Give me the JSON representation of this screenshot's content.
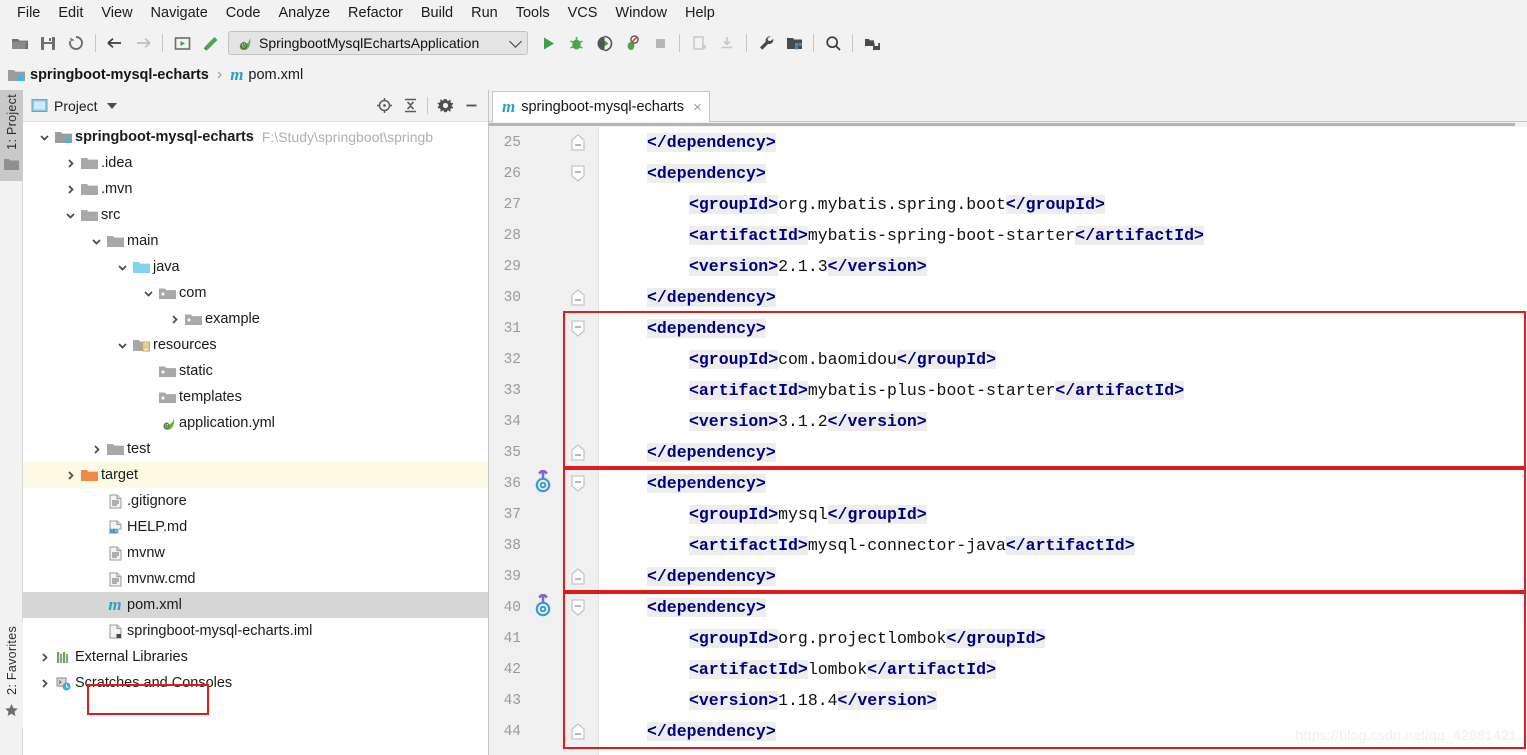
{
  "window": {
    "menu": [
      "File",
      "Edit",
      "View",
      "Navigate",
      "Code",
      "Analyze",
      "Refactor",
      "Build",
      "Run",
      "Tools",
      "VCS",
      "Window",
      "Help"
    ]
  },
  "toolbar": {
    "icons_left": [
      "open-folder-icon",
      "save-all-icon",
      "sync-icon",
      "back-arrow-icon",
      "forward-arrow-icon",
      "run-anything-icon",
      "build-hammer-icon"
    ],
    "run_config": {
      "label": "SpringbootMysqlEchartsApplication",
      "icon": "spring-boot-leaf-icon",
      "dropdown": "chevron-down-icon"
    },
    "icons_right": [
      "run-icon",
      "debug-icon",
      "run-with-coverage-icon",
      "profiler-icon",
      "stop-icon",
      "update-app-icon",
      "install-icon",
      "settings-wrench-icon",
      "project-structure-icon",
      "search-everywhere-icon",
      "save-layout-icon"
    ]
  },
  "breadcrumb": {
    "project": "springboot-mysql-echarts",
    "separator": "›",
    "file": "pom.xml",
    "file_icon": "maven-m-icon",
    "project_icon": "module-folder-icon"
  },
  "left_strips": [
    {
      "label": "1: Project",
      "icon": "project-folder-icon",
      "active": true
    },
    {
      "label": "2: Favorites",
      "icon": "star-icon",
      "active": false
    }
  ],
  "project_panel": {
    "title": "Project",
    "title_icon": "project-view-icon",
    "dropdown": "chevron-down-icon",
    "buttons": [
      "locate-target-icon",
      "collapse-all-icon",
      "settings-gear-icon",
      "hide-minus-icon"
    ],
    "tree": [
      {
        "label": "springboot-mysql-echarts",
        "path": "F:\\Study\\springboot\\springb",
        "depth": 0,
        "arrow": "down",
        "icon": "module-folder-icon",
        "bold": true,
        "state": "normal"
      },
      {
        "label": ".idea",
        "depth": 1,
        "arrow": "right",
        "icon": "folder-icon",
        "state": "normal"
      },
      {
        "label": ".mvn",
        "depth": 1,
        "arrow": "right",
        "icon": "folder-icon",
        "state": "normal"
      },
      {
        "label": "src",
        "depth": 1,
        "arrow": "down",
        "icon": "folder-icon",
        "state": "normal"
      },
      {
        "label": "main",
        "depth": 2,
        "arrow": "down",
        "icon": "folder-icon",
        "state": "normal"
      },
      {
        "label": "java",
        "depth": 3,
        "arrow": "down",
        "icon": "source-root-folder-icon",
        "state": "normal"
      },
      {
        "label": "com",
        "depth": 4,
        "arrow": "down",
        "icon": "package-icon",
        "state": "normal"
      },
      {
        "label": "example",
        "depth": 5,
        "arrow": "right",
        "icon": "package-icon",
        "state": "normal"
      },
      {
        "label": "resources",
        "depth": 3,
        "arrow": "down",
        "icon": "resource-root-folder-icon",
        "state": "normal"
      },
      {
        "label": "static",
        "depth": 4,
        "arrow": "none",
        "icon": "package-icon",
        "state": "normal"
      },
      {
        "label": "templates",
        "depth": 4,
        "arrow": "none",
        "icon": "package-icon",
        "state": "normal"
      },
      {
        "label": "application.yml",
        "depth": 4,
        "arrow": "none",
        "icon": "spring-yaml-icon",
        "state": "normal"
      },
      {
        "label": "test",
        "depth": 2,
        "arrow": "right",
        "icon": "folder-icon",
        "state": "normal"
      },
      {
        "label": "target",
        "depth": 1,
        "arrow": "right",
        "icon": "excluded-folder-icon",
        "state": "highlighted"
      },
      {
        "label": ".gitignore",
        "depth": 2,
        "arrow": "none",
        "icon": "text-file-icon",
        "state": "normal"
      },
      {
        "label": "HELP.md",
        "depth": 2,
        "arrow": "none",
        "icon": "markdown-file-icon",
        "state": "normal"
      },
      {
        "label": "mvnw",
        "depth": 2,
        "arrow": "none",
        "icon": "text-file-icon",
        "state": "normal"
      },
      {
        "label": "mvnw.cmd",
        "depth": 2,
        "arrow": "none",
        "icon": "text-file-icon",
        "state": "normal"
      },
      {
        "label": "pom.xml",
        "depth": 2,
        "arrow": "none",
        "icon": "maven-m-icon",
        "state": "selected"
      },
      {
        "label": "springboot-mysql-echarts.iml",
        "depth": 2,
        "arrow": "none",
        "icon": "iml-file-icon",
        "state": "normal"
      },
      {
        "label": "External Libraries",
        "depth": 0,
        "arrow": "right",
        "icon": "libraries-icon",
        "state": "normal"
      },
      {
        "label": "Scratches and Consoles",
        "depth": 0,
        "arrow": "right",
        "icon": "scratches-icon",
        "state": "normal"
      }
    ]
  },
  "editor": {
    "tab": {
      "label": "springboot-mysql-echarts",
      "icon": "maven-m-icon",
      "close": "×"
    },
    "first_line_number": 25,
    "lines": [
      {
        "n": 25,
        "indent": 1,
        "fold": "end",
        "gutter_icon": null,
        "tokens": [
          {
            "t": "tag",
            "v": "</dependency>"
          }
        ]
      },
      {
        "n": 26,
        "indent": 1,
        "fold": "start",
        "gutter_icon": null,
        "tokens": [
          {
            "t": "tag",
            "v": "<dependency>"
          }
        ]
      },
      {
        "n": 27,
        "indent": 2,
        "fold": null,
        "gutter_icon": null,
        "tokens": [
          {
            "t": "tag",
            "v": "<groupId>"
          },
          {
            "t": "val",
            "v": "org.mybatis.spring.boot"
          },
          {
            "t": "tag",
            "v": "</groupId>"
          }
        ]
      },
      {
        "n": 28,
        "indent": 2,
        "fold": null,
        "gutter_icon": null,
        "tokens": [
          {
            "t": "tag",
            "v": "<artifactId>"
          },
          {
            "t": "val",
            "v": "mybatis-spring-boot-starter"
          },
          {
            "t": "tag",
            "v": "</artifactId>"
          }
        ]
      },
      {
        "n": 29,
        "indent": 2,
        "fold": null,
        "gutter_icon": null,
        "tokens": [
          {
            "t": "tag",
            "v": "<version>"
          },
          {
            "t": "val",
            "v": "2.1.3"
          },
          {
            "t": "tag",
            "v": "</version>"
          }
        ]
      },
      {
        "n": 30,
        "indent": 1,
        "fold": "end",
        "gutter_icon": null,
        "tokens": [
          {
            "t": "tag",
            "v": "</dependency>"
          }
        ]
      },
      {
        "n": 31,
        "indent": 1,
        "fold": "start",
        "gutter_icon": null,
        "tokens": [
          {
            "t": "tag",
            "v": "<dependency>"
          }
        ]
      },
      {
        "n": 32,
        "indent": 2,
        "fold": null,
        "gutter_icon": null,
        "tokens": [
          {
            "t": "tag",
            "v": "<groupId>"
          },
          {
            "t": "val",
            "v": "com.baomidou"
          },
          {
            "t": "tag",
            "v": "</groupId>"
          }
        ]
      },
      {
        "n": 33,
        "indent": 2,
        "fold": null,
        "gutter_icon": null,
        "tokens": [
          {
            "t": "tag",
            "v": "<artifactId>"
          },
          {
            "t": "val",
            "v": "mybatis-plus-boot-starter"
          },
          {
            "t": "tag",
            "v": "</artifactId>"
          }
        ]
      },
      {
        "n": 34,
        "indent": 2,
        "fold": null,
        "gutter_icon": null,
        "tokens": [
          {
            "t": "tag",
            "v": "<version>"
          },
          {
            "t": "val",
            "v": "3.1.2"
          },
          {
            "t": "tag",
            "v": "</version>"
          }
        ]
      },
      {
        "n": 35,
        "indent": 1,
        "fold": "end",
        "gutter_icon": null,
        "tokens": [
          {
            "t": "tag",
            "v": "</dependency>"
          }
        ]
      },
      {
        "n": 36,
        "indent": 1,
        "fold": "start",
        "gutter_icon": "dependency-analyzer-icon",
        "tokens": [
          {
            "t": "tag",
            "v": "<dependency>"
          }
        ]
      },
      {
        "n": 37,
        "indent": 2,
        "fold": null,
        "gutter_icon": null,
        "tokens": [
          {
            "t": "tag",
            "v": "<groupId>"
          },
          {
            "t": "val",
            "v": "mysql"
          },
          {
            "t": "tag",
            "v": "</groupId>"
          }
        ]
      },
      {
        "n": 38,
        "indent": 2,
        "fold": null,
        "gutter_icon": null,
        "tokens": [
          {
            "t": "tag",
            "v": "<artifactId>"
          },
          {
            "t": "val",
            "v": "mysql-connector-java"
          },
          {
            "t": "tag",
            "v": "</artifactId>"
          }
        ]
      },
      {
        "n": 39,
        "indent": 1,
        "fold": "end",
        "gutter_icon": null,
        "tokens": [
          {
            "t": "tag",
            "v": "</dependency>"
          }
        ]
      },
      {
        "n": 40,
        "indent": 1,
        "fold": "start",
        "gutter_icon": "dependency-analyzer-icon",
        "tokens": [
          {
            "t": "tag",
            "v": "<dependency>"
          }
        ]
      },
      {
        "n": 41,
        "indent": 2,
        "fold": null,
        "gutter_icon": null,
        "tokens": [
          {
            "t": "tag",
            "v": "<groupId>"
          },
          {
            "t": "val",
            "v": "org.projectlombok"
          },
          {
            "t": "tag",
            "v": "</groupId>"
          }
        ]
      },
      {
        "n": 42,
        "indent": 2,
        "fold": null,
        "gutter_icon": null,
        "tokens": [
          {
            "t": "tag",
            "v": "<artifactId>"
          },
          {
            "t": "val",
            "v": "lombok"
          },
          {
            "t": "tag",
            "v": "</artifactId>"
          }
        ]
      },
      {
        "n": 43,
        "indent": 2,
        "fold": null,
        "gutter_icon": null,
        "tokens": [
          {
            "t": "tag",
            "v": "<version>"
          },
          {
            "t": "val",
            "v": "1.18.4"
          },
          {
            "t": "tag",
            "v": "</version>"
          }
        ]
      },
      {
        "n": 44,
        "indent": 1,
        "fold": "end",
        "gutter_icon": null,
        "tokens": [
          {
            "t": "tag",
            "v": "</dependency>"
          }
        ]
      }
    ],
    "annotations": [
      {
        "name": "mybatis-plus-dependency-highlight",
        "from": 31,
        "to": 35
      },
      {
        "name": "mysql-dependency-highlight",
        "from": 36,
        "to": 39
      },
      {
        "name": "lombok-dependency-highlight",
        "from": 40,
        "to": 44
      }
    ],
    "annotation_color": "#e01b1b"
  },
  "watermark": "https://blog.csdn.net/qq_42881421"
}
